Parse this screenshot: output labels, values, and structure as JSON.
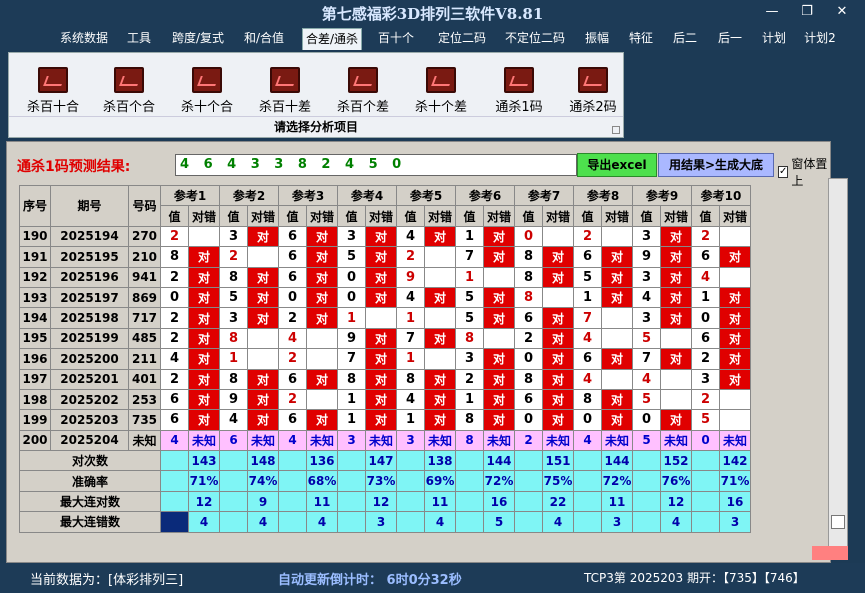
{
  "window": {
    "title": "第七感福彩3D排列三软件V8.81",
    "minimize": "—",
    "maximize": "❐",
    "close": "✕"
  },
  "menu": [
    "系统数据",
    "工具",
    "跨度/复式",
    "和/合值",
    "合差/通杀",
    "百十个",
    "定位二码",
    "不定位二码",
    "振幅",
    "特征",
    "后二",
    "后一",
    "计划",
    "计划2"
  ],
  "menu_active": 4,
  "ribbon": {
    "buttons": [
      "杀百十合",
      "杀百个合",
      "杀十个合",
      "杀百十差",
      "杀百个差",
      "杀十个差",
      "通杀1码",
      "通杀2码"
    ],
    "caption": "请选择分析项目"
  },
  "prediction": {
    "label": "通杀1码预测结果:",
    "value": "4 6 4 3 3 8 2 4 5 0",
    "export_label": "导出excel",
    "generate_label": "用结果>生成大底",
    "topmost_label": "窗体置上",
    "topmost_checked": "✓"
  },
  "table": {
    "headers": {
      "seq": "序号",
      "period": "期号",
      "number": "号码",
      "ref_prefix": "参考",
      "value": "值",
      "result": "对错"
    },
    "refs": [
      "参考1",
      "参考2",
      "参考3",
      "参考4",
      "参考5",
      "参考6",
      "参考7",
      "参考8",
      "参考9",
      "参考10"
    ],
    "hit_text": "对",
    "rows": [
      {
        "seq": "190",
        "period": "2025194",
        "num": "270",
        "vals": [
          "2",
          "3",
          "6",
          "3",
          "4",
          "1",
          "0",
          "2",
          "3",
          "2"
        ],
        "hits": [
          0,
          1,
          1,
          1,
          1,
          1,
          0,
          0,
          1,
          0
        ]
      },
      {
        "seq": "191",
        "period": "2025195",
        "num": "210",
        "vals": [
          "8",
          "2",
          "6",
          "5",
          "2",
          "7",
          "8",
          "6",
          "9",
          "6"
        ],
        "hits": [
          1,
          0,
          1,
          1,
          0,
          1,
          1,
          1,
          1,
          1
        ]
      },
      {
        "seq": "192",
        "period": "2025196",
        "num": "941",
        "vals": [
          "2",
          "8",
          "6",
          "0",
          "9",
          "1",
          "8",
          "5",
          "3",
          "4"
        ],
        "hits": [
          1,
          1,
          1,
          1,
          0,
          0,
          1,
          1,
          1,
          0
        ]
      },
      {
        "seq": "193",
        "period": "2025197",
        "num": "869",
        "vals": [
          "0",
          "5",
          "0",
          "0",
          "4",
          "5",
          "8",
          "1",
          "4",
          "1"
        ],
        "hits": [
          1,
          1,
          1,
          1,
          1,
          1,
          0,
          1,
          1,
          1
        ]
      },
      {
        "seq": "194",
        "period": "2025198",
        "num": "717",
        "vals": [
          "2",
          "3",
          "2",
          "1",
          "1",
          "5",
          "6",
          "7",
          "3",
          "0"
        ],
        "hits": [
          1,
          1,
          1,
          0,
          0,
          1,
          1,
          0,
          1,
          1
        ]
      },
      {
        "seq": "195",
        "period": "2025199",
        "num": "485",
        "vals": [
          "2",
          "8",
          "4",
          "9",
          "7",
          "8",
          "2",
          "4",
          "5",
          "6"
        ],
        "hits": [
          1,
          0,
          0,
          1,
          1,
          0,
          1,
          0,
          0,
          1
        ]
      },
      {
        "seq": "196",
        "period": "2025200",
        "num": "211",
        "vals": [
          "4",
          "1",
          "2",
          "7",
          "1",
          "3",
          "0",
          "6",
          "7",
          "2"
        ],
        "hits": [
          1,
          0,
          0,
          1,
          0,
          1,
          1,
          1,
          1,
          1
        ]
      },
      {
        "seq": "197",
        "period": "2025201",
        "num": "401",
        "vals": [
          "2",
          "8",
          "6",
          "8",
          "8",
          "2",
          "8",
          "4",
          "4",
          "3"
        ],
        "hits": [
          1,
          1,
          1,
          1,
          1,
          1,
          1,
          0,
          0,
          1
        ]
      },
      {
        "seq": "198",
        "period": "2025202",
        "num": "253",
        "vals": [
          "6",
          "9",
          "2",
          "1",
          "4",
          "1",
          "6",
          "8",
          "5",
          "2"
        ],
        "hits": [
          1,
          1,
          0,
          1,
          1,
          1,
          1,
          1,
          0,
          0
        ]
      },
      {
        "seq": "199",
        "period": "2025203",
        "num": "735",
        "vals": [
          "6",
          "4",
          "6",
          "1",
          "1",
          "8",
          "0",
          "0",
          "0",
          "5"
        ],
        "hits": [
          1,
          1,
          1,
          1,
          1,
          1,
          1,
          1,
          1,
          0
        ]
      }
    ],
    "future": {
      "seq": "200",
      "period": "2025204",
      "num": "未知",
      "vals": [
        "4",
        "6",
        "4",
        "3",
        "3",
        "8",
        "2",
        "4",
        "5",
        "0"
      ],
      "text": "未知"
    },
    "stats": [
      {
        "label": "对次数",
        "values": [
          "143",
          "148",
          "136",
          "147",
          "138",
          "144",
          "151",
          "144",
          "152",
          "142"
        ]
      },
      {
        "label": "准确率",
        "values": [
          "71%",
          "74%",
          "68%",
          "73%",
          "69%",
          "72%",
          "75%",
          "72%",
          "76%",
          "71%"
        ]
      },
      {
        "label": "最大连对数",
        "values": [
          "12",
          "9",
          "11",
          "12",
          "11",
          "16",
          "22",
          "11",
          "12",
          "16"
        ]
      },
      {
        "label": "最大连错数",
        "values": [
          "4",
          "4",
          "4",
          "3",
          "4",
          "5",
          "4",
          "3",
          "4",
          "3"
        ]
      }
    ]
  },
  "status": {
    "current": "当前数据为：[体彩排列三]",
    "countdown": "自动更新倒计时：  6时0分32秒",
    "issue": "TCP3第 2025203 期开：【735】【746】"
  }
}
